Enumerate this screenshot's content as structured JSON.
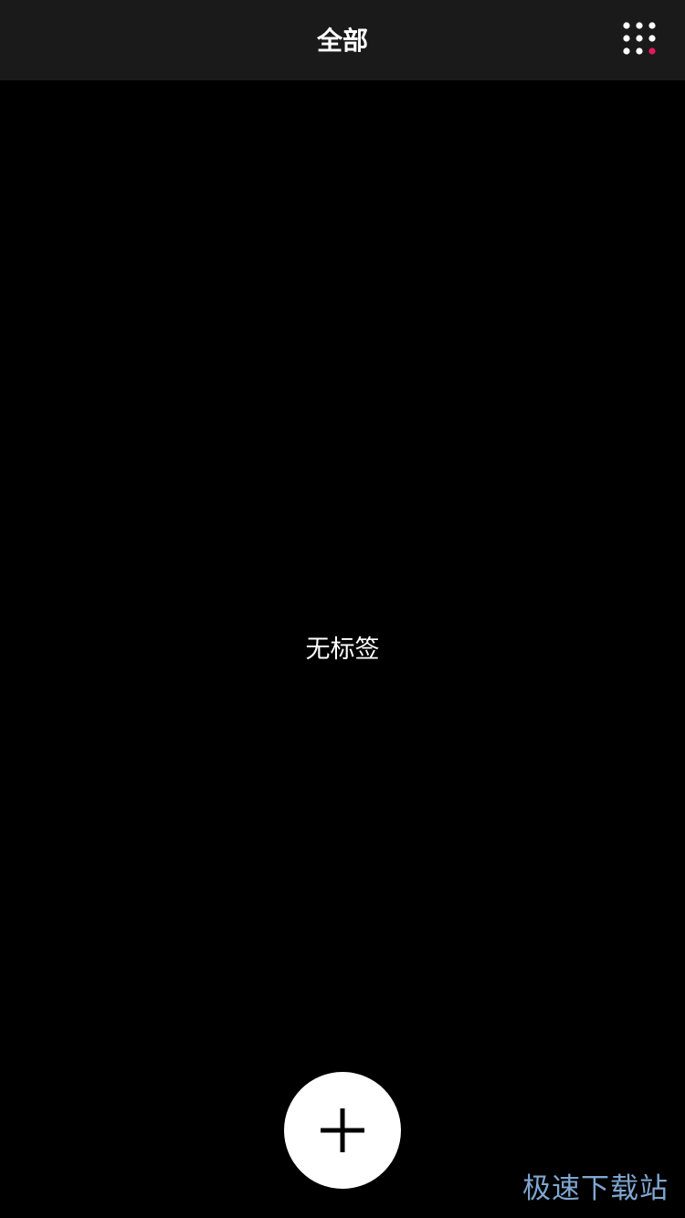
{
  "header": {
    "title": "全部",
    "menu_icon": "grid-dots-icon",
    "notification_dot_color": "#e8175d"
  },
  "main": {
    "empty_text": "无标签"
  },
  "fab": {
    "icon": "plus-icon"
  },
  "watermark": {
    "text": "极速下载站"
  },
  "colors": {
    "top_bar": "#1a1a1a",
    "background": "#000000",
    "fab": "#ffffff",
    "watermark": "#7fa6cf"
  }
}
